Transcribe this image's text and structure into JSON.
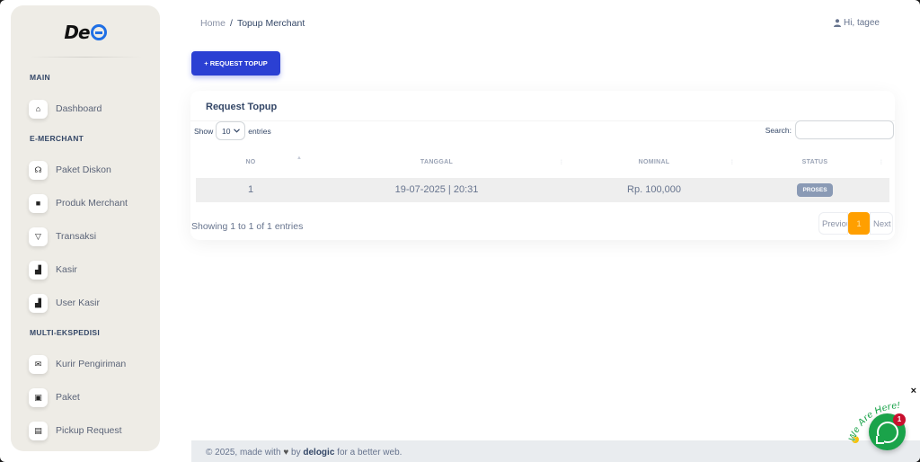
{
  "brand": {
    "logo_text": "De"
  },
  "sidebar": {
    "sections": [
      {
        "title": "MAIN"
      },
      {
        "title": "E-MERCHANT"
      },
      {
        "title": "MULTI-EKSPEDISI"
      }
    ],
    "items": [
      {
        "label": "Dashboard",
        "icon": "home-icon",
        "glyph": "⌂"
      },
      {
        "label": "Paket Diskon",
        "icon": "headset-icon",
        "glyph": "☊"
      },
      {
        "label": "Produk Merchant",
        "icon": "box-icon",
        "glyph": "■"
      },
      {
        "label": "Transaksi",
        "icon": "basket-icon",
        "glyph": "▽"
      },
      {
        "label": "Kasir",
        "icon": "cash-register-icon",
        "glyph": "▟"
      },
      {
        "label": "User Kasir",
        "icon": "cash-register-icon",
        "glyph": "▟"
      },
      {
        "label": "Kurir Pengiriman",
        "icon": "envelope-icon",
        "glyph": "✉"
      },
      {
        "label": "Paket",
        "icon": "package-icon",
        "glyph": "▣"
      },
      {
        "label": "Pickup Request",
        "icon": "window-icon",
        "glyph": "▤"
      }
    ]
  },
  "header": {
    "breadcrumb_home": "Home",
    "breadcrumb_sep": "/",
    "breadcrumb_current": "Topup Merchant",
    "greeting": "Hi, tagee"
  },
  "toolbar": {
    "request_label": "+ REQUEST TOPUP"
  },
  "card": {
    "title": "Request Topup",
    "show_label": "Show",
    "entries_label": "entries",
    "page_size": "10",
    "search_label": "Search:",
    "search_value": "",
    "columns": [
      "NO",
      "TANGGAL",
      "NOMINAL",
      "STATUS"
    ],
    "rows": [
      {
        "no": "1",
        "tanggal": "19-07-2025 | 20:31",
        "nominal": "Rp. 100,000",
        "status": "PROSES"
      }
    ],
    "info": "Showing 1 to 1 of 1 entries",
    "pager": {
      "prev": "Previous",
      "current": "1",
      "next": "Next"
    }
  },
  "footer": {
    "prefix": "© 2025, made with",
    "by": "by",
    "brand": "delogic",
    "suffix": "for a better web."
  },
  "chat": {
    "tagline": "We Are Here!",
    "badge_count": "1",
    "close": "×"
  },
  "colors": {
    "primary": "#2b40d3",
    "active_page": "#ff9f00",
    "badge": "#8a9ab5",
    "sidebar_bg": "#eeece6",
    "chat_green": "#1aa34a"
  }
}
